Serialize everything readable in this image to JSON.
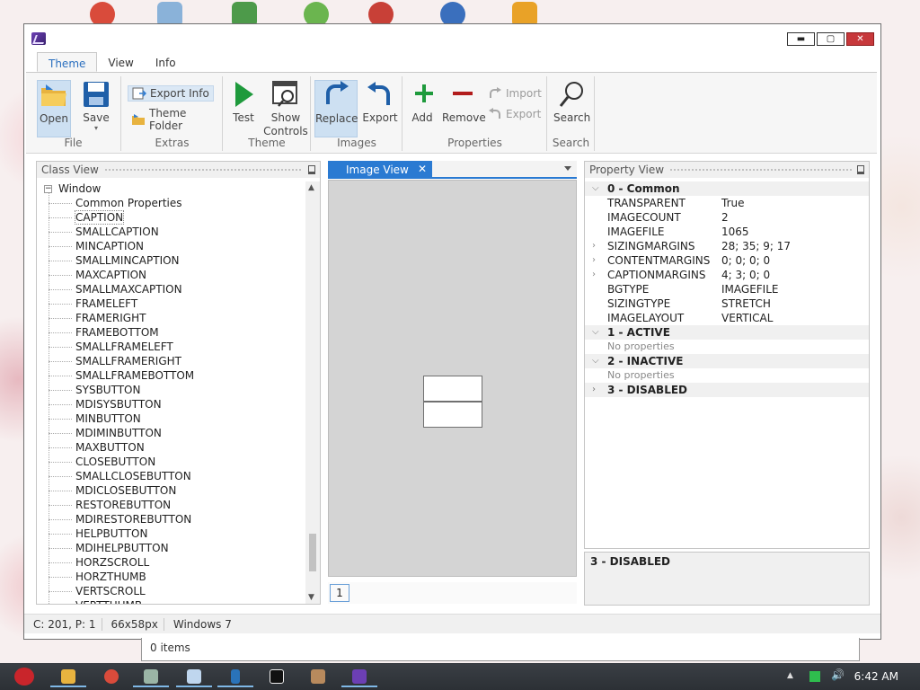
{
  "window": {
    "title": "",
    "controls": {
      "minimize": "▬",
      "maximize": "▢",
      "close": "✕"
    }
  },
  "ribbon": {
    "tabs": [
      "Theme",
      "View",
      "Info"
    ],
    "active_tab": "Theme",
    "groups": {
      "file": {
        "label": "File",
        "open": "Open",
        "save": "Save"
      },
      "extras": {
        "label": "Extras",
        "export_info": "Export Info",
        "theme_folder": "Theme Folder"
      },
      "theme": {
        "label": "Theme",
        "test": "Test",
        "show_controls": "Show Controls"
      },
      "images": {
        "label": "Images",
        "replace": "Replace",
        "export": "Export"
      },
      "properties": {
        "label": "Properties",
        "add": "Add",
        "remove": "Remove",
        "import": "Import",
        "export": "Export"
      },
      "search": {
        "label": "Search",
        "search": "Search"
      }
    }
  },
  "class_view": {
    "title": "Class View",
    "root": "Window",
    "items": [
      "Common Properties",
      "CAPTION",
      "SMALLCAPTION",
      "MINCAPTION",
      "SMALLMINCAPTION",
      "MAXCAPTION",
      "SMALLMAXCAPTION",
      "FRAMELEFT",
      "FRAMERIGHT",
      "FRAMEBOTTOM",
      "SMALLFRAMELEFT",
      "SMALLFRAMERIGHT",
      "SMALLFRAMEBOTTOM",
      "SYSBUTTON",
      "MDISYSBUTTON",
      "MINBUTTON",
      "MDIMINBUTTON",
      "MAXBUTTON",
      "CLOSEBUTTON",
      "SMALLCLOSEBUTTON",
      "MDICLOSEBUTTON",
      "RESTOREBUTTON",
      "MDIRESTOREBUTTON",
      "HELPBUTTON",
      "MDIHELPBUTTON",
      "HORZSCROLL",
      "HORZTHUMB",
      "VERTSCROLL",
      "VERTTHUMB"
    ],
    "selected": "CAPTION"
  },
  "image_view": {
    "tab_label": "Image View",
    "page": "1"
  },
  "property_view": {
    "title": "Property View",
    "categories": [
      {
        "name": "0 - Common",
        "expanded": true,
        "props": [
          {
            "key": "TRANSPARENT",
            "value": "True",
            "expandable": false
          },
          {
            "key": "IMAGECOUNT",
            "value": "2",
            "expandable": false
          },
          {
            "key": "IMAGEFILE",
            "value": "1065",
            "expandable": false
          },
          {
            "key": "SIZINGMARGINS",
            "value": "28; 35; 9; 17",
            "expandable": true
          },
          {
            "key": "CONTENTMARGINS",
            "value": "0; 0; 0; 0",
            "expandable": true
          },
          {
            "key": "CAPTIONMARGINS",
            "value": "4; 3; 0; 0",
            "expandable": true
          },
          {
            "key": "BGTYPE",
            "value": "IMAGEFILE",
            "expandable": false
          },
          {
            "key": "SIZINGTYPE",
            "value": "STRETCH",
            "expandable": false
          },
          {
            "key": "IMAGELAYOUT",
            "value": "VERTICAL",
            "expandable": false
          }
        ]
      },
      {
        "name": "1 - ACTIVE",
        "expanded": true,
        "empty_text": "No properties"
      },
      {
        "name": "2 - INACTIVE",
        "expanded": true,
        "empty_text": "No properties"
      },
      {
        "name": "3 - DISABLED",
        "expanded": false
      }
    ],
    "description": "3 - DISABLED"
  },
  "statusbar": {
    "cell1": "C: 201, P: 1",
    "cell2": "66x58px",
    "cell3": "Windows 7"
  },
  "background_window": {
    "status": "0 items"
  },
  "taskbar": {
    "clock": "6:42 AM"
  },
  "colors": {
    "accent": "#2a7ad2",
    "close": "#c7383b",
    "ribbon_bg": "#f6f6f6"
  }
}
